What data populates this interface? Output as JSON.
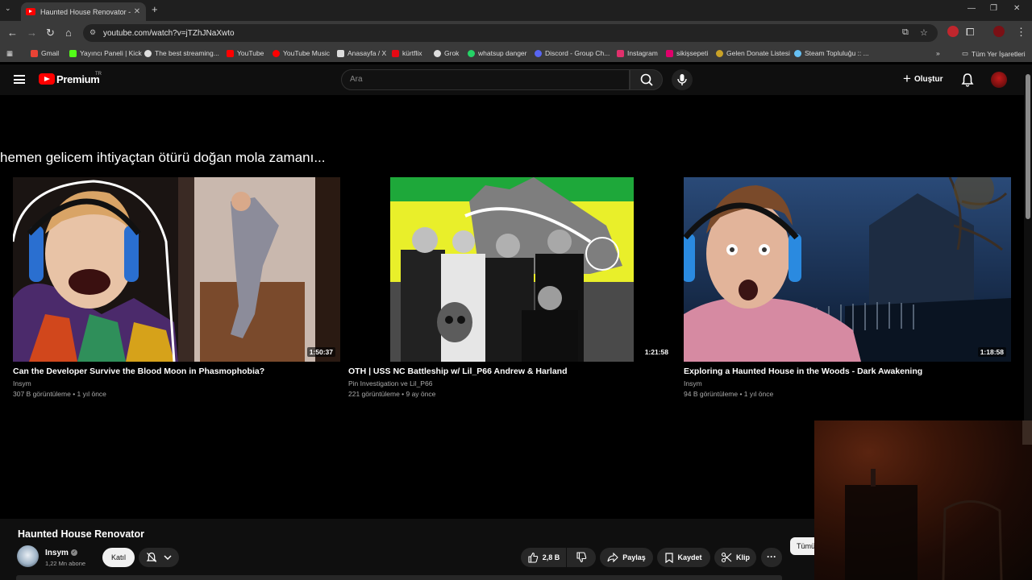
{
  "browser": {
    "tab_title": "Haunted House Renovator - Yo",
    "url": "youtube.com/watch?v=jTZhJNaXwto",
    "bookmarks": [
      {
        "label": "Gmail",
        "color": "#ea4335"
      },
      {
        "label": "Yayıncı Paneli | Kick",
        "color": "#53fc18"
      },
      {
        "label": "The best streaming...",
        "color": "#dddddd"
      },
      {
        "label": "YouTube",
        "color": "#ff0000"
      },
      {
        "label": "YouTube Music",
        "color": "#ff0000"
      },
      {
        "label": "Anasayfa / X",
        "color": "#dddddd"
      },
      {
        "label": "kürtflix",
        "color": "#e50914"
      },
      {
        "label": "Grok",
        "color": "#dddddd"
      },
      {
        "label": "whatsup danger",
        "color": "#25d366"
      },
      {
        "label": "Discord - Group Ch...",
        "color": "#5865f2"
      },
      {
        "label": "Instagram",
        "color": "#e1306c"
      },
      {
        "label": "sikişsepeti",
        "color": "#e0006b"
      },
      {
        "label": "Gelen Donate Listesi",
        "color": "#c9a227"
      },
      {
        "label": "Steam Topluluğu :: ...",
        "color": "#66c0f4"
      }
    ],
    "all_bookmarks": "Tüm Yer İşaretleri"
  },
  "youtube": {
    "brand": "Premium",
    "region": "TR",
    "search_placeholder": "Ara",
    "create_label": "Oluştur"
  },
  "endscreen": {
    "message": "hemen gelicem ihtiyaçtan ötürü doğan mola zamanı...",
    "videos": [
      {
        "title": "Can the Developer Survive the Blood Moon in Phasmophobia?",
        "channel": "Insym",
        "meta": "307 B görüntüleme • 1 yıl önce",
        "duration": "1:50:37"
      },
      {
        "title": "OTH | USS NC Battleship w/ Lil_P66 Andrew & Harland",
        "channel": "Pin Investigation ve Lil_P66",
        "meta": "221 görüntüleme • 9 ay önce",
        "duration": "1:21:58"
      },
      {
        "title": "Exploring a Haunted House in the Woods - Dark Awakening",
        "channel": "Insym",
        "meta": "94 B görüntüleme • 1 yıl önce",
        "duration": "1:18:58"
      }
    ]
  },
  "video": {
    "title": "Haunted House Renovator",
    "channel": "Insym",
    "subscribers": "1,22 Mn abone",
    "join_label": "Katıl",
    "likes": "2,8 B",
    "share_label": "Paylaş",
    "save_label": "Kaydet",
    "clip_label": "Klip",
    "chip_label": "Tümü"
  }
}
